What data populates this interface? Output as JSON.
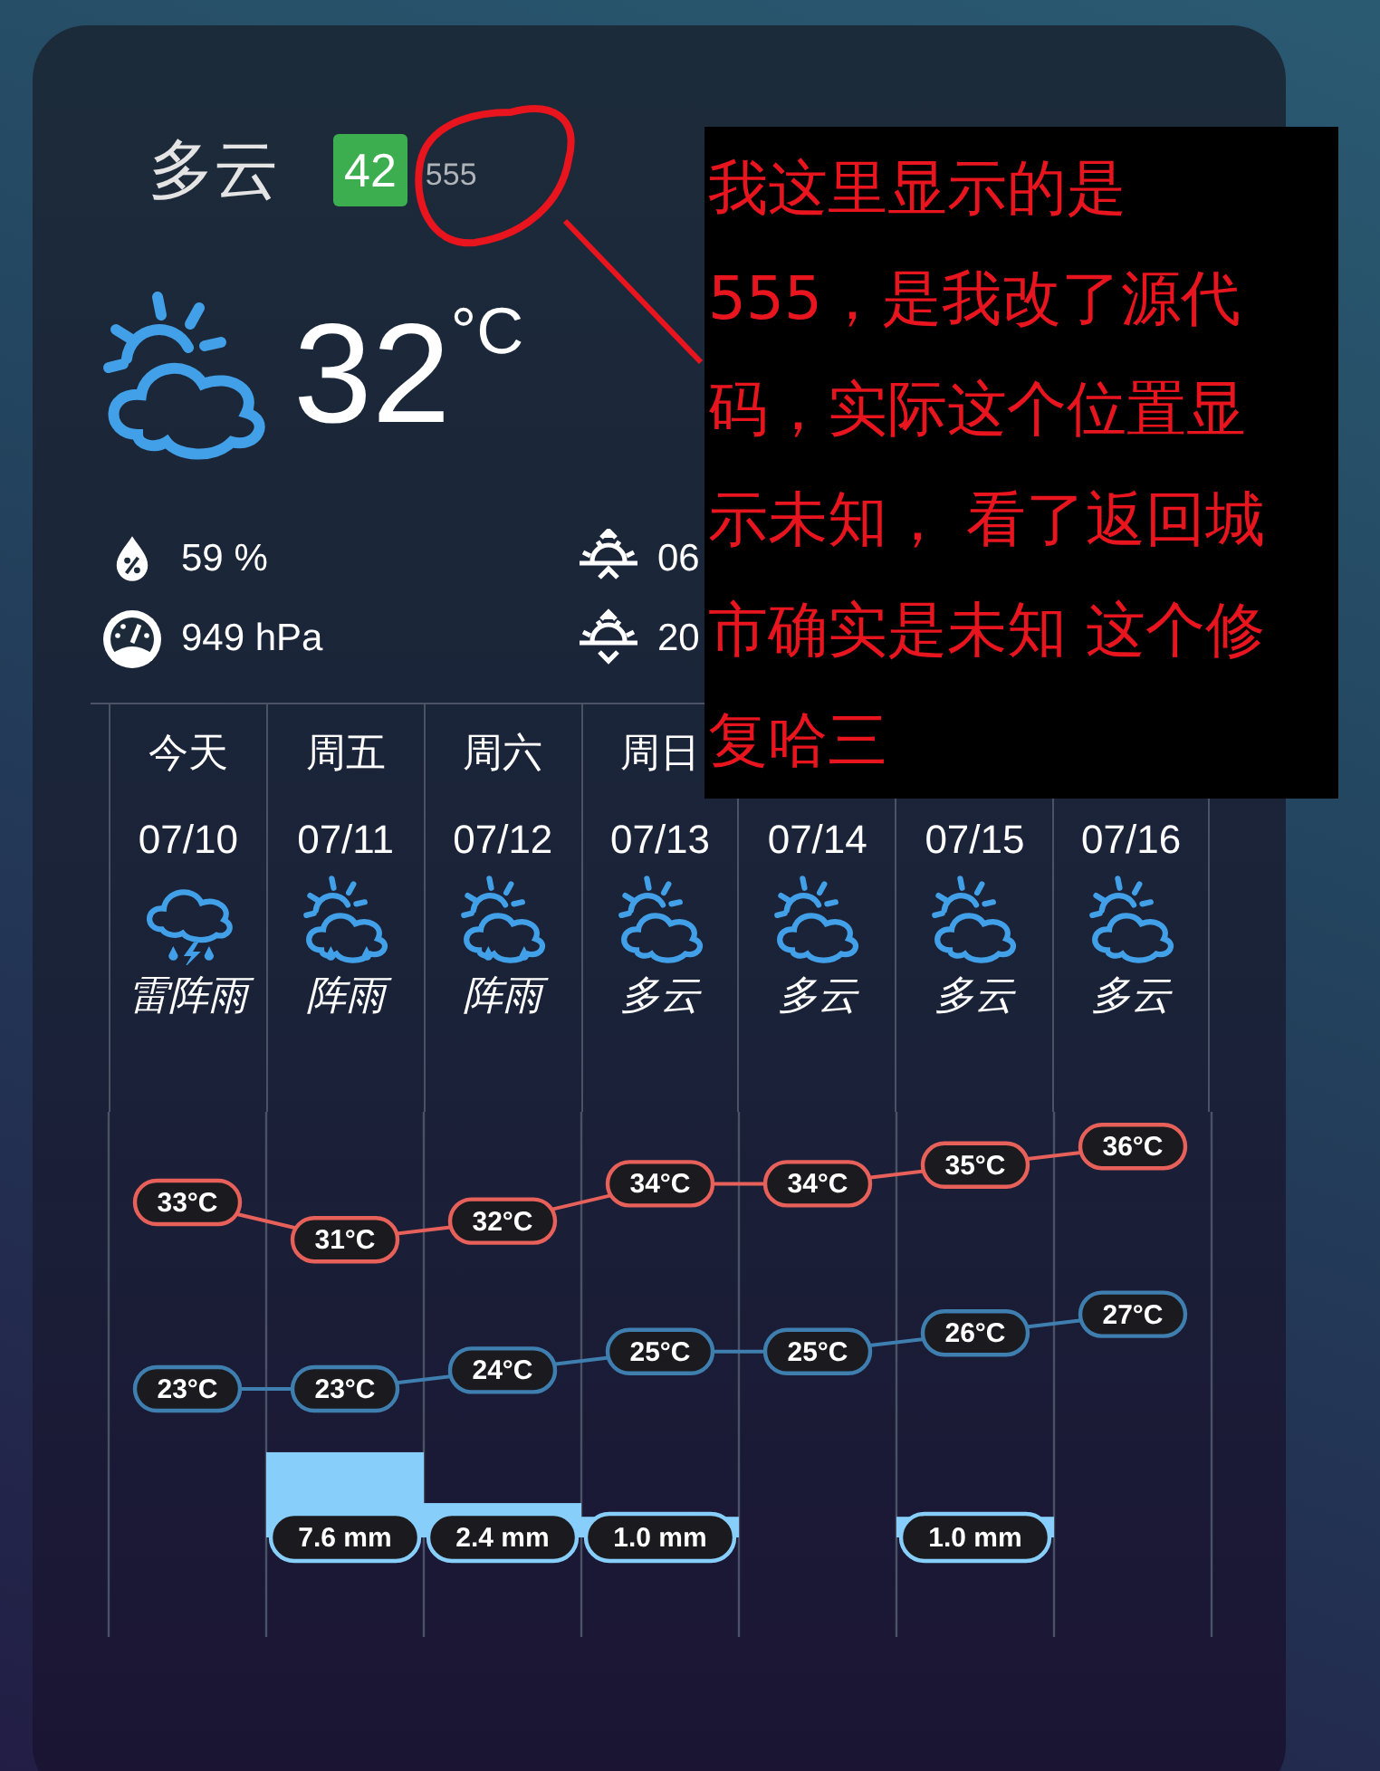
{
  "current": {
    "condition": "多云",
    "aqi": "42",
    "extra": "555",
    "kind": "partly-cloudy",
    "temperature": "32",
    "unit": "°C"
  },
  "stats": [
    {
      "kind": "humidity",
      "value": "59 %"
    },
    {
      "kind": "sunrise",
      "value": "06"
    },
    {
      "kind": "pressure",
      "value": "949 hPa"
    },
    {
      "kind": "sunset",
      "value": "20"
    }
  ],
  "forecast": [
    {
      "weekday": "今天",
      "date": "07/10",
      "kind": "thunderstorm",
      "condition": "雷阵雨",
      "high": "33°C",
      "low": "23°C"
    },
    {
      "weekday": "周五",
      "date": "07/11",
      "kind": "showers",
      "condition": "阵雨",
      "high": "31°C",
      "low": "23°C",
      "precipitation": "7.6 mm"
    },
    {
      "weekday": "周六",
      "date": "07/12",
      "kind": "showers",
      "condition": "阵雨",
      "high": "32°C",
      "low": "24°C",
      "precipitation": "2.4 mm"
    },
    {
      "weekday": "周日",
      "date": "07/13",
      "kind": "partly-cloudy",
      "condition": "多云",
      "high": "34°C",
      "low": "25°C",
      "precipitation": "1.0 mm"
    },
    {
      "date": "07/14",
      "kind": "partly-cloudy",
      "condition": "多云",
      "high": "34°C",
      "low": "25°C"
    },
    {
      "date": "07/15",
      "kind": "partly-cloudy",
      "condition": "多云",
      "high": "35°C",
      "low": "26°C",
      "precipitation": "1.0 mm"
    },
    {
      "date": "07/16",
      "kind": "partly-cloudy",
      "condition": "多云",
      "high": "36°C",
      "low": "27°C"
    }
  ],
  "annotation": {
    "lines": [
      "我这里显示的是",
      "555，是我改了源代",
      "码，实际这个位置显",
      "示未知， 看了返回城",
      "市确实是未知 这个修",
      "复哈三"
    ]
  }
}
